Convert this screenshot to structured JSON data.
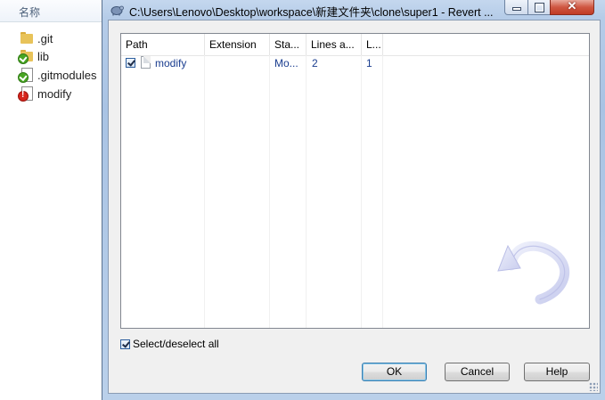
{
  "explorer": {
    "column_header": "名称",
    "files": [
      {
        "name": ".git",
        "icon": "folder-icon",
        "status": "none"
      },
      {
        "name": "lib",
        "icon": "folder-icon",
        "status": "normal"
      },
      {
        "name": ".gitmodules",
        "icon": "file-icon",
        "status": "normal"
      },
      {
        "name": "modify",
        "icon": "file-icon",
        "status": "modified"
      }
    ]
  },
  "dialog": {
    "title": "C:\\Users\\Lenovo\\Desktop\\workspace\\新建文件夹\\clone\\super1 - Revert ...",
    "close_glyph": "✕",
    "columns": [
      "Path",
      "Extension",
      "Sta...",
      "Lines a...",
      "L..."
    ],
    "rows": [
      {
        "checked": true,
        "path": "modify",
        "extension": "",
        "status": "Mo...",
        "lines_added": "2",
        "lines_removed": "1"
      }
    ],
    "select_all_label": "Select/deselect all",
    "select_all_checked": true,
    "ok_label": "OK",
    "cancel_label": "Cancel",
    "help_label": "Help"
  },
  "colors": {
    "link_text": "#1a3d8f",
    "titlebar": "#c4d7ee",
    "close_button": "#cf5742"
  }
}
